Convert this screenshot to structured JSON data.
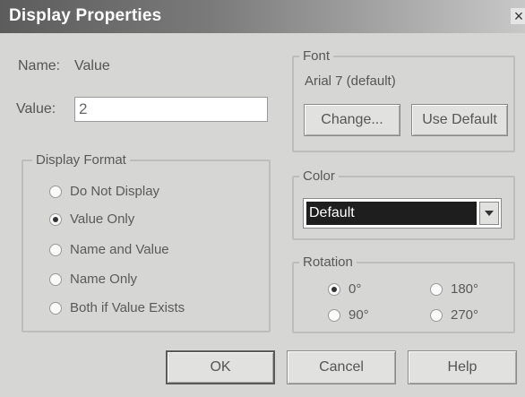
{
  "window": {
    "title": "Display Properties",
    "close_glyph": "×"
  },
  "name_row": {
    "label": "Name:",
    "value": "Value"
  },
  "value_row": {
    "label": "Value:",
    "input_value": "2"
  },
  "display_format": {
    "legend": "Display Format",
    "options": [
      {
        "label": "Do Not Display",
        "checked": false
      },
      {
        "label": "Value Only",
        "checked": true
      },
      {
        "label": "Name and Value",
        "checked": false
      },
      {
        "label": "Name Only",
        "checked": false
      },
      {
        "label": "Both if Value Exists",
        "checked": false
      }
    ]
  },
  "font": {
    "legend": "Font",
    "current": "Arial 7 (default)",
    "change_label": "Change...",
    "use_default_label": "Use Default"
  },
  "color": {
    "legend": "Color",
    "selected": "Default"
  },
  "rotation": {
    "legend": "Rotation",
    "options": [
      {
        "label": "0°",
        "checked": true
      },
      {
        "label": "180°",
        "checked": false
      },
      {
        "label": "90°",
        "checked": false
      },
      {
        "label": "270°",
        "checked": false
      }
    ]
  },
  "footer": {
    "ok_label": "OK",
    "cancel_label": "Cancel",
    "help_label": "Help"
  },
  "icons": {
    "close": "close-icon",
    "dropdown": "chevron-down-icon"
  }
}
